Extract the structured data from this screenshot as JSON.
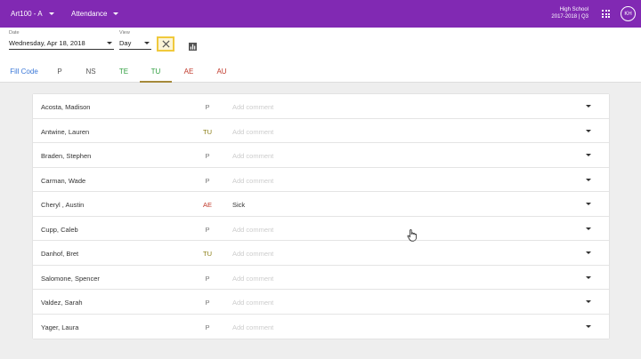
{
  "header": {
    "class_select": "Art100 - A",
    "view_select": "Attendance",
    "school_line1": "High School",
    "school_line2": "2017-2018 | Q3",
    "avatar_initials": "KH",
    "apps_icon": "apps-grid-icon",
    "bg_color": "#8129b3"
  },
  "toolbar": {
    "date_label": "Date",
    "date_value": "Wednesday, Apr 18, 2018",
    "view_label": "View",
    "view_value": "Day",
    "clear_icon": "close-icon",
    "report_icon": "bar-chart-icon"
  },
  "codes": [
    {
      "label": "Fill Code",
      "color": "#3b78d8"
    },
    {
      "label": "P",
      "color": "#555555"
    },
    {
      "label": "NS",
      "color": "#555555"
    },
    {
      "label": "TE",
      "color": "#2e9e3e"
    },
    {
      "label": "TU",
      "color": "#2e9e3e"
    },
    {
      "label": "AE",
      "color": "#c0392b"
    },
    {
      "label": "AU",
      "color": "#c0392b"
    }
  ],
  "students": [
    {
      "name": "Acosta, Madison",
      "code": "P",
      "code_color": "#777777",
      "comment": "",
      "placeholder": "Add comment"
    },
    {
      "name": "Antwine, Lauren",
      "code": "TU",
      "code_color": "#8a7d13",
      "comment": "",
      "placeholder": "Add comment"
    },
    {
      "name": "Braden, Stephen",
      "code": "P",
      "code_color": "#777777",
      "comment": "",
      "placeholder": "Add comment"
    },
    {
      "name": "Carman, Wade",
      "code": "P",
      "code_color": "#777777",
      "comment": "",
      "placeholder": "Add comment"
    },
    {
      "name": "Cheryl , Austin",
      "code": "AE",
      "code_color": "#c0392b",
      "comment": "Sick",
      "placeholder": "Add comment"
    },
    {
      "name": "Cupp, Caleb",
      "code": "P",
      "code_color": "#777777",
      "comment": "",
      "placeholder": "Add comment"
    },
    {
      "name": "Danhof, Bret",
      "code": "TU",
      "code_color": "#8a7d13",
      "comment": "",
      "placeholder": "Add comment"
    },
    {
      "name": "Salomone, Spencer",
      "code": "P",
      "code_color": "#777777",
      "comment": "",
      "placeholder": "Add comment"
    },
    {
      "name": "Valdez, Sarah",
      "code": "P",
      "code_color": "#777777",
      "comment": "",
      "placeholder": "Add comment"
    },
    {
      "name": "Yager, Laura",
      "code": "P",
      "code_color": "#777777",
      "comment": "",
      "placeholder": "Add comment"
    }
  ]
}
